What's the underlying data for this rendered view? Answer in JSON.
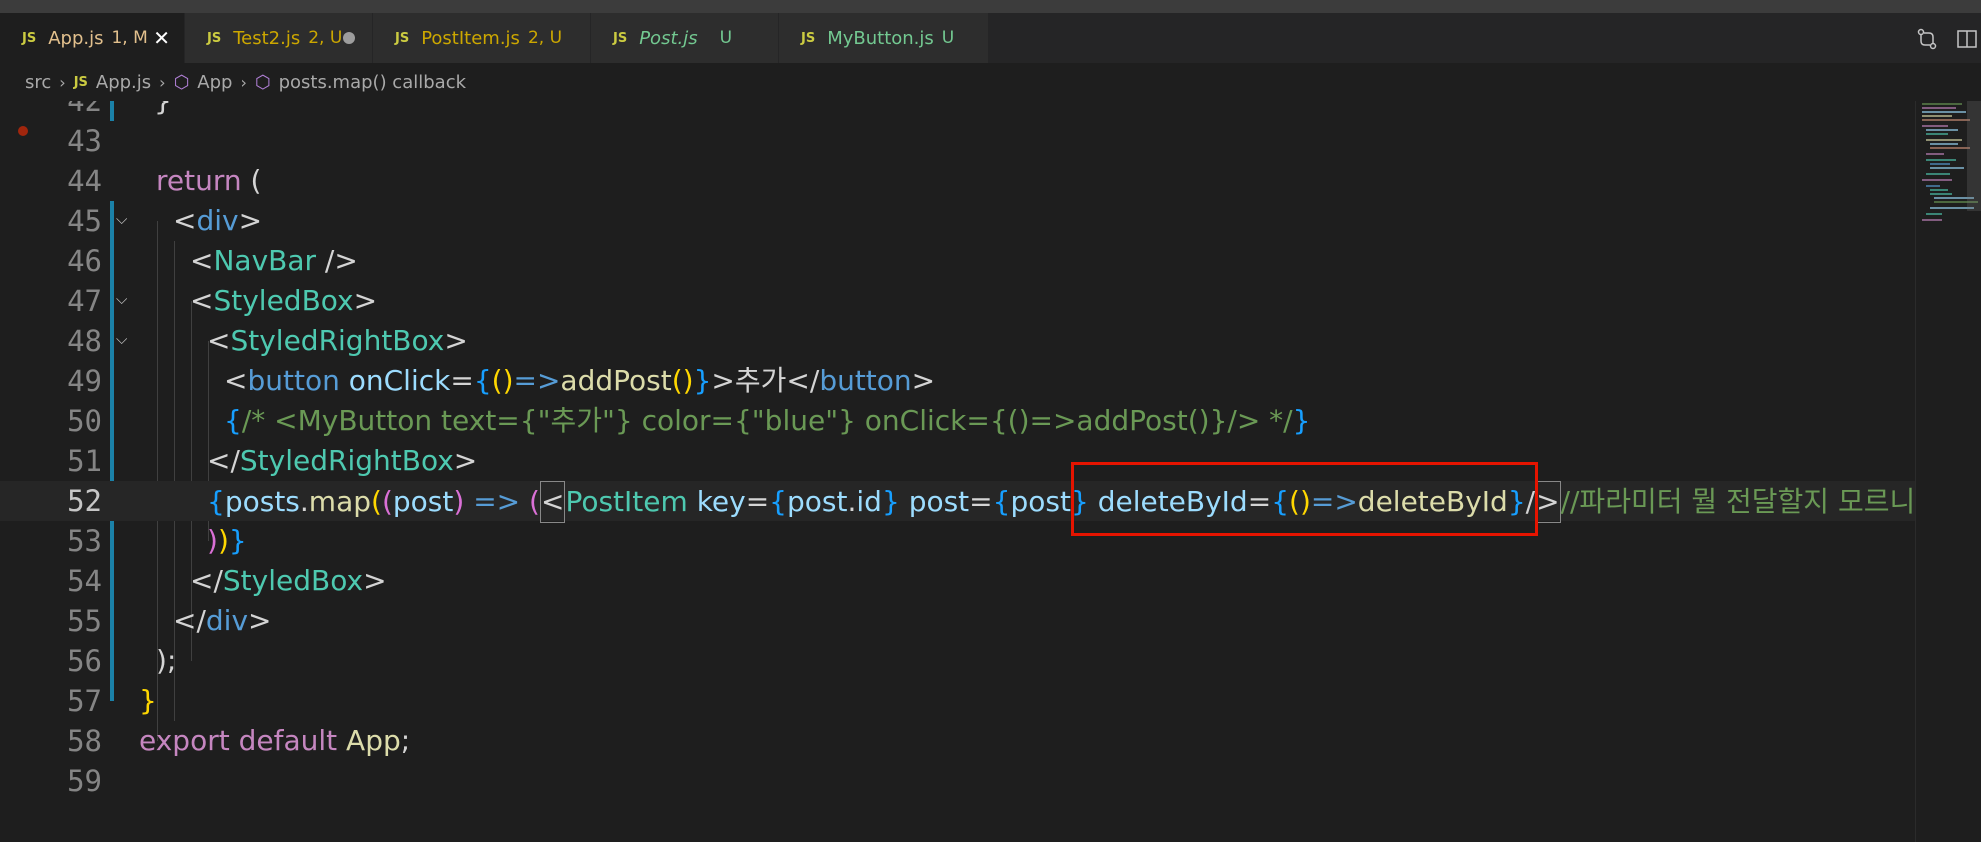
{
  "tabs": [
    {
      "name": "App.js",
      "status": "1, M",
      "color": "#e2c08d",
      "active": true,
      "italic": false
    },
    {
      "name": "Test2.js",
      "status": "2, U",
      "color": "#cca700",
      "active": false,
      "italic": false
    },
    {
      "name": "PostItem.js",
      "status": "2, U",
      "color": "#cca700",
      "active": false,
      "italic": false
    },
    {
      "name": "Post.js",
      "status": "U",
      "color": "#73c991",
      "active": false,
      "italic": true
    },
    {
      "name": "MyButton.js",
      "status": "U",
      "color": "#73c991",
      "active": false,
      "italic": false
    }
  ],
  "breadcrumb": {
    "folder": "src",
    "file": "App.js",
    "component": "App",
    "callback": "posts.map() callback"
  },
  "editor": {
    "current_line": 52,
    "lines": [
      {
        "n": "42",
        "text": "}"
      },
      {
        "n": "43",
        "text": ""
      },
      {
        "n": "44",
        "text": "return ("
      },
      {
        "n": "45",
        "text": "<div>"
      },
      {
        "n": "46",
        "text": "<NavBar />"
      },
      {
        "n": "47",
        "text": "<StyledBox>"
      },
      {
        "n": "48",
        "text": "<StyledRightBox>"
      },
      {
        "n": "49",
        "text": "<button onClick={()=>addPost()}>추가</button>"
      },
      {
        "n": "50",
        "text": "{/* <MyButton text={\"추가\"} color={\"blue\"} onClick={()=>addPost()}/> */}"
      },
      {
        "n": "51",
        "text": "</StyledRightBox>"
      },
      {
        "n": "52",
        "text": "{posts.map((post) => (<PostItem key={post.id} post={post} deleteById={()=>deleteById}/>//파라미터 뭘 전달할지 모르니까"
      },
      {
        "n": "53",
        "text": "))}"
      },
      {
        "n": "54",
        "text": "</StyledBox>"
      },
      {
        "n": "55",
        "text": "</div>"
      },
      {
        "n": "56",
        "text": ");"
      },
      {
        "n": "57",
        "text": "}"
      },
      {
        "n": "58",
        "text": "export default App;"
      },
      {
        "n": "59",
        "text": ""
      }
    ]
  },
  "tokens": {
    "l44": [
      "return",
      "("
    ],
    "l45": [
      "<",
      "div",
      ">"
    ],
    "l46": [
      "<",
      "NavBar",
      " />"
    ],
    "l47": [
      "<",
      "StyledBox",
      ">"
    ],
    "l48": [
      "<",
      "StyledRightBox",
      ">"
    ],
    "l49": [
      "<",
      "button",
      " ",
      "onClick",
      "=",
      "{",
      "()",
      "=>",
      "addPost",
      "()",
      "}",
      ">",
      "추가",
      "</",
      "button",
      ">"
    ],
    "l50": [
      "{",
      "/* <MyButton text={\"추가\"} color={\"blue\"} onClick={()=>addPost()}/> */",
      "}"
    ],
    "l51": [
      "</",
      "StyledRightBox",
      ">"
    ],
    "l52": [
      "{",
      "posts",
      ".",
      "map",
      "(",
      "(",
      "post",
      ")",
      " => ",
      "(",
      "<",
      "PostItem",
      " ",
      "key",
      "=",
      "{",
      "post",
      ".",
      "id",
      "}",
      " ",
      "post",
      "=",
      "{",
      "post",
      "}",
      " ",
      "deleteById",
      "=",
      "{",
      "()",
      "=>",
      "deleteById",
      "}",
      "/",
      ">",
      "//파라미터 뭘 전달할지 모르니까"
    ],
    "l53": [
      ")",
      ")",
      "}"
    ],
    "l54": [
      "</",
      "StyledBox",
      ">"
    ],
    "l55": [
      "</",
      "div",
      ">"
    ],
    "l56": [
      ")",
      ";"
    ],
    "l57": [
      "}"
    ],
    "l58": [
      "export",
      " ",
      "default",
      " ",
      "App",
      ";"
    ]
  }
}
